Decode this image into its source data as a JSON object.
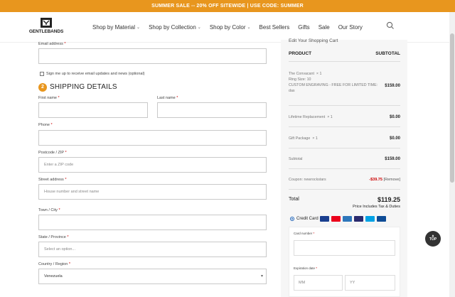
{
  "promo": {
    "text": "SUMMER SALE -- 20% OFF SITEWIDE | USE CODE: SUMMER"
  },
  "header": {
    "logo_text": "GENTLEBANDS",
    "nav": [
      {
        "label": "Shop by Material",
        "dropdown": true
      },
      {
        "label": "Shop by Collection",
        "dropdown": true
      },
      {
        "label": "Shop by Color",
        "dropdown": true
      },
      {
        "label": "Best Sellers",
        "dropdown": false
      },
      {
        "label": "Gifts",
        "dropdown": false
      },
      {
        "label": "Sale",
        "dropdown": false
      },
      {
        "label": "Our Story",
        "dropdown": false
      }
    ],
    "search_icon": "search-icon"
  },
  "form": {
    "email": {
      "label": "Email address",
      "required": "*",
      "value": ""
    },
    "newsletter_label": "Sign me up to receive email updates and news (optional)",
    "step_number": "2",
    "section_title": "SHIPPING DETAILS",
    "first_name": {
      "label": "First name",
      "required": "*"
    },
    "last_name": {
      "label": "Last name",
      "required": "*"
    },
    "phone": {
      "label": "Phone",
      "required": "*"
    },
    "postcode": {
      "label": "Postcode / ZIP",
      "required": "*",
      "placeholder": "Enter a ZIP code"
    },
    "street": {
      "label": "Street address",
      "required": "*",
      "placeholder": "House number and street name"
    },
    "town": {
      "label": "Town / City",
      "required": "*"
    },
    "state": {
      "label": "State / Province",
      "required": "*",
      "placeholder": "Select an option..."
    },
    "country": {
      "label": "Country / Region",
      "required": "*",
      "value": "Venezuela"
    }
  },
  "summary": {
    "title": "Edit Your Shopping Cart",
    "col_product": "PRODUCT",
    "col_subtotal": "SUBTOTAL",
    "items": [
      {
        "name": "The Convacant",
        "qty": "× 1",
        "detail1": "Ring Size: 10",
        "detail2": "CUSTOM ENGRAVING - FREE FOR LIMITED TIME:",
        "detail3": "das",
        "price": "$159.00"
      },
      {
        "name": "Lifetime Replacement",
        "qty": "× 1",
        "price": "$0.00"
      },
      {
        "name": "Gift Package",
        "qty": "× 1",
        "price": "$0.00"
      }
    ],
    "subtotal_label": "Subtotal",
    "subtotal_value": "$159.00",
    "coupon_label": "Coupon: newrockstars",
    "coupon_value": "-$39.75",
    "coupon_remove": "[Remove]",
    "total_label": "Total",
    "total_value": "$119.25",
    "tax_note": "Price Includes Tax & Duties",
    "payment_label": "Credit Card",
    "card_number_label": "Card number",
    "expiration_label": "Expiration date",
    "month_placeholder": "MM",
    "year_placeholder": "YY",
    "card_colors": [
      "#1a3f8f",
      "#eb001b",
      "#2e77bb",
      "#2a2a6e",
      "#00a2e5",
      "#0e4c96"
    ]
  },
  "top_button": {
    "label": "TOP"
  }
}
